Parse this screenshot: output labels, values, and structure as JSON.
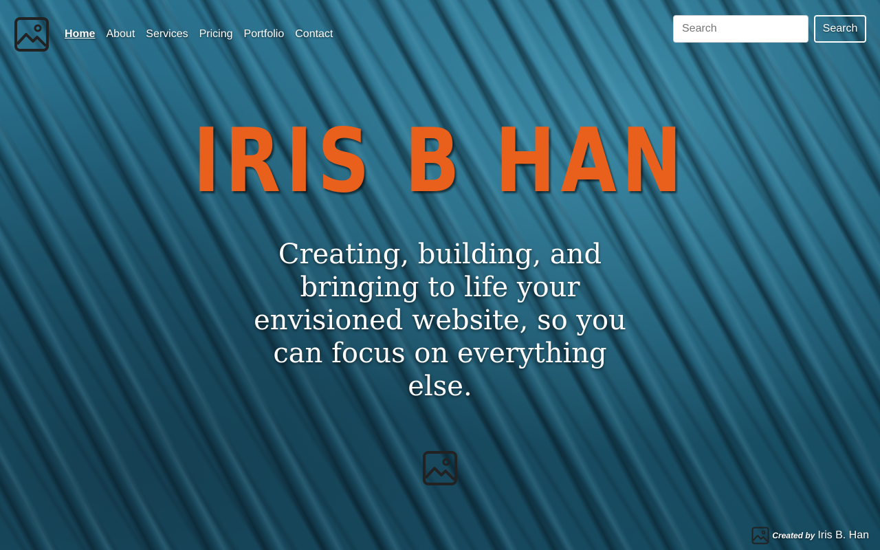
{
  "colors": {
    "accent_orange": "#e8601c",
    "background_teal": "#1f5a70",
    "icon_dark": "#222222"
  },
  "header": {
    "logo_icon": "image-placeholder-icon",
    "nav": [
      {
        "label": "Home",
        "active": true
      },
      {
        "label": "About",
        "active": false
      },
      {
        "label": "Services",
        "active": false
      },
      {
        "label": "Pricing",
        "active": false
      },
      {
        "label": "Portfolio",
        "active": false
      },
      {
        "label": "Contact",
        "active": false
      }
    ],
    "search": {
      "placeholder": "Search",
      "value": "",
      "button_label": "Search"
    }
  },
  "hero": {
    "title": "IRIS B HAN",
    "tagline": "Creating, building, and bringing to life your envisioned website, so you can focus on everything else.",
    "center_icon": "image-placeholder-icon"
  },
  "footer": {
    "credit_icon": "image-placeholder-icon",
    "credit_prefix": "Created by",
    "credit_name": "Iris B. Han"
  }
}
